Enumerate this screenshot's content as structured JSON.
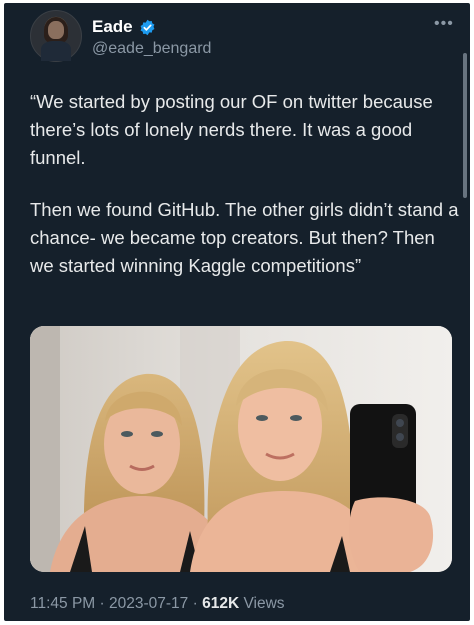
{
  "author": {
    "name": "Eade",
    "handle": "@eade_bengard",
    "verified": true
  },
  "more_label": "•••",
  "tweet": {
    "paragraphs": [
      "“We started by posting our OF on twitter because there’s lots of lonely nerds there. It was a good funnel.",
      "Then we found GitHub. The other girls didn’t stand a chance- we became top creators. But then? Then we started winning Kaggle competitions”"
    ]
  },
  "meta": {
    "time": "11:45 PM",
    "separator": "·",
    "date": "2023-07-17",
    "views_count": "612K",
    "views_label": "Views"
  },
  "colors": {
    "background": "#15202b",
    "text": "#e7e9ea",
    "secondary": "#8b98a5",
    "verified": "#1d9bf0"
  }
}
